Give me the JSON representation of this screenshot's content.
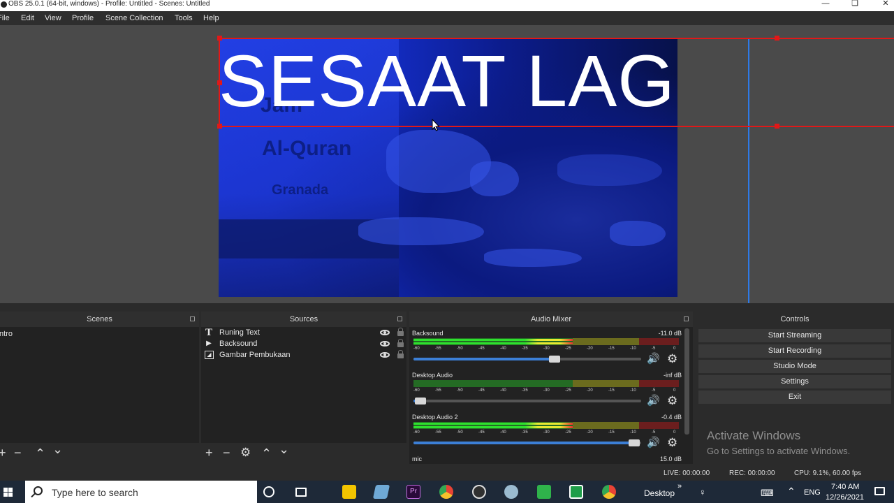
{
  "window": {
    "title": "OBS 25.0.1 (64-bit, windows) - Profile: Untitled - Scenes: Untitled"
  },
  "menu": [
    "File",
    "Edit",
    "View",
    "Profile",
    "Scene Collection",
    "Tools",
    "Help"
  ],
  "preview": {
    "text_source": "SESAAT LAG",
    "book_texts": [
      "Jam",
      "Al-Quran",
      "Granada"
    ]
  },
  "docks": {
    "scenes": {
      "title": "Scenes",
      "items": [
        "Intro"
      ]
    },
    "sources": {
      "title": "Sources",
      "items": [
        {
          "label": "Runing Text",
          "icon": "text-icon"
        },
        {
          "label": "Backsound",
          "icon": "media-play-icon"
        },
        {
          "label": "Gambar Pembukaan",
          "icon": "image-icon"
        }
      ]
    },
    "mixer": {
      "title": "Audio Mixer",
      "ticks": [
        "-60",
        "-55",
        "-50",
        "-45",
        "-40",
        "-35",
        "-30",
        "-25",
        "-20",
        "-15",
        "-10",
        "-5",
        "0"
      ],
      "channels": [
        {
          "name": "Backsound",
          "db": "-11.0 dB",
          "level": 0.6,
          "volume": 0.62
        },
        {
          "name": "Desktop Audio",
          "db": "-inf dB",
          "level": 0.0,
          "volume": 0.03
        },
        {
          "name": "Desktop Audio 2",
          "db": "-0.4 dB",
          "level": 0.6,
          "volume": 0.97
        },
        {
          "name": "mic",
          "db": "15.0 dB"
        }
      ]
    },
    "controls": {
      "title": "Controls",
      "buttons": [
        "Start Streaming",
        "Start Recording",
        "Studio Mode",
        "Settings",
        "Exit"
      ]
    }
  },
  "watermark": {
    "line1": "Activate Windows",
    "line2": "Go to Settings to activate Windows."
  },
  "status": {
    "live": "LIVE: 00:00:00",
    "rec": "REC: 00:00:00",
    "cpu": "CPU: 9.1%, 60.00 fps"
  },
  "taskbar": {
    "search_placeholder": "Type here to search",
    "desktop_label": "Desktop",
    "lang": "ENG",
    "time": "7:40 AM",
    "date": "12/26/2021"
  },
  "colors": {
    "selection": "#e11818",
    "guide": "#2d7ae8",
    "accent": "#3c7fd6"
  }
}
